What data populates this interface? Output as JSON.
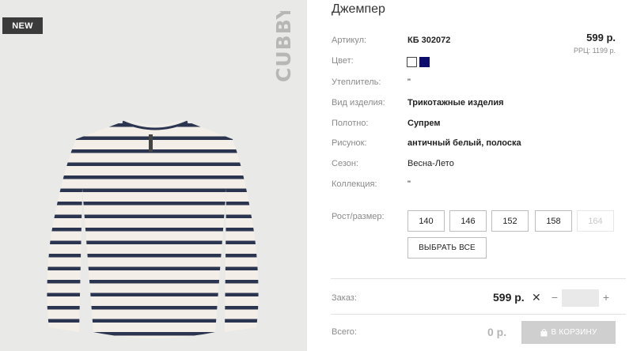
{
  "product": {
    "badge": "NEW",
    "brand": "CUBBY",
    "title": "Джемпер"
  },
  "pricing": {
    "price": "599 р.",
    "rrp": "РРЦ: 1199 р."
  },
  "attributes": [
    {
      "label": "Артикул:",
      "value": "КБ 302072"
    },
    {
      "label": "Цвет:",
      "value": ""
    },
    {
      "label": "Утеплитель:",
      "value": "\""
    },
    {
      "label": "Вид изделия:",
      "value": "Трикотажные изделия"
    },
    {
      "label": "Полотно:",
      "value": "Супрем"
    },
    {
      "label": "Рисунок:",
      "value": "античный белый, полоска"
    },
    {
      "label": "Сезон:",
      "value": "Весна-Лето"
    },
    {
      "label": "Коллекция:",
      "value": "\""
    },
    {
      "label": "Рост/размер:",
      "value": ""
    }
  ],
  "colors": [
    "#ffffff",
    "#0d0d6b"
  ],
  "sizes": [
    {
      "label": "140",
      "available": true
    },
    {
      "label": "146",
      "available": true
    },
    {
      "label": "152",
      "available": true
    },
    {
      "label": "158",
      "available": true
    },
    {
      "label": "164",
      "available": false
    }
  ],
  "select_all_label": "ВЫБРАТЬ ВСЕ",
  "order": {
    "label": "Заказ:",
    "price": "599 р.",
    "times": "✕",
    "minus": "−",
    "plus": "+",
    "quantity": ""
  },
  "total": {
    "label": "Всего:",
    "value": "0 р.",
    "cart_button": "В КОРЗИНУ"
  }
}
